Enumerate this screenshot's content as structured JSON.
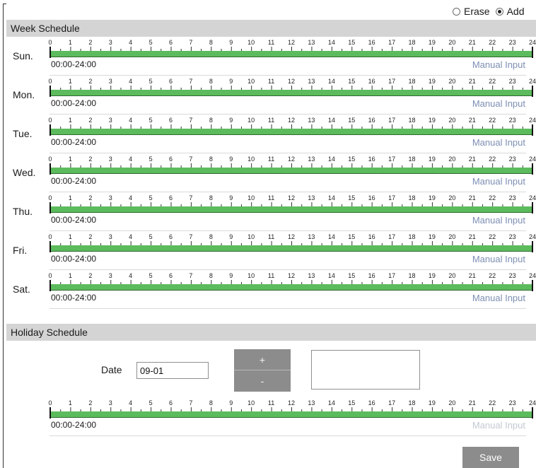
{
  "mode": {
    "erase_label": "Erase",
    "add_label": "Add",
    "selected": "Add"
  },
  "week": {
    "title": "Week Schedule",
    "days": [
      {
        "label": "Sun.",
        "range": "00:00-24:00"
      },
      {
        "label": "Mon.",
        "range": "00:00-24:00"
      },
      {
        "label": "Tue.",
        "range": "00:00-24:00"
      },
      {
        "label": "Wed.",
        "range": "00:00-24:00"
      },
      {
        "label": "Thu.",
        "range": "00:00-24:00"
      },
      {
        "label": "Fri.",
        "range": "00:00-24:00"
      },
      {
        "label": "Sat.",
        "range": "00:00-24:00"
      }
    ],
    "manual_input_label": "Manual Input"
  },
  "hours": [
    "0",
    "1",
    "2",
    "3",
    "4",
    "5",
    "6",
    "7",
    "8",
    "9",
    "10",
    "11",
    "12",
    "13",
    "14",
    "15",
    "16",
    "17",
    "18",
    "19",
    "20",
    "21",
    "22",
    "23",
    "24"
  ],
  "holiday": {
    "title": "Holiday Schedule",
    "date_label": "Date",
    "date_value": "09-01",
    "add_button": "+",
    "remove_button": "-",
    "range": "00:00-24:00",
    "manual_input_label": "Manual Input"
  },
  "save_label": "Save",
  "colors": {
    "schedule_bar": "#5cbb5c",
    "section_header": "#d4d4d4",
    "manual_input_link": "#7d8fb3",
    "button": "#8c8c8c"
  }
}
